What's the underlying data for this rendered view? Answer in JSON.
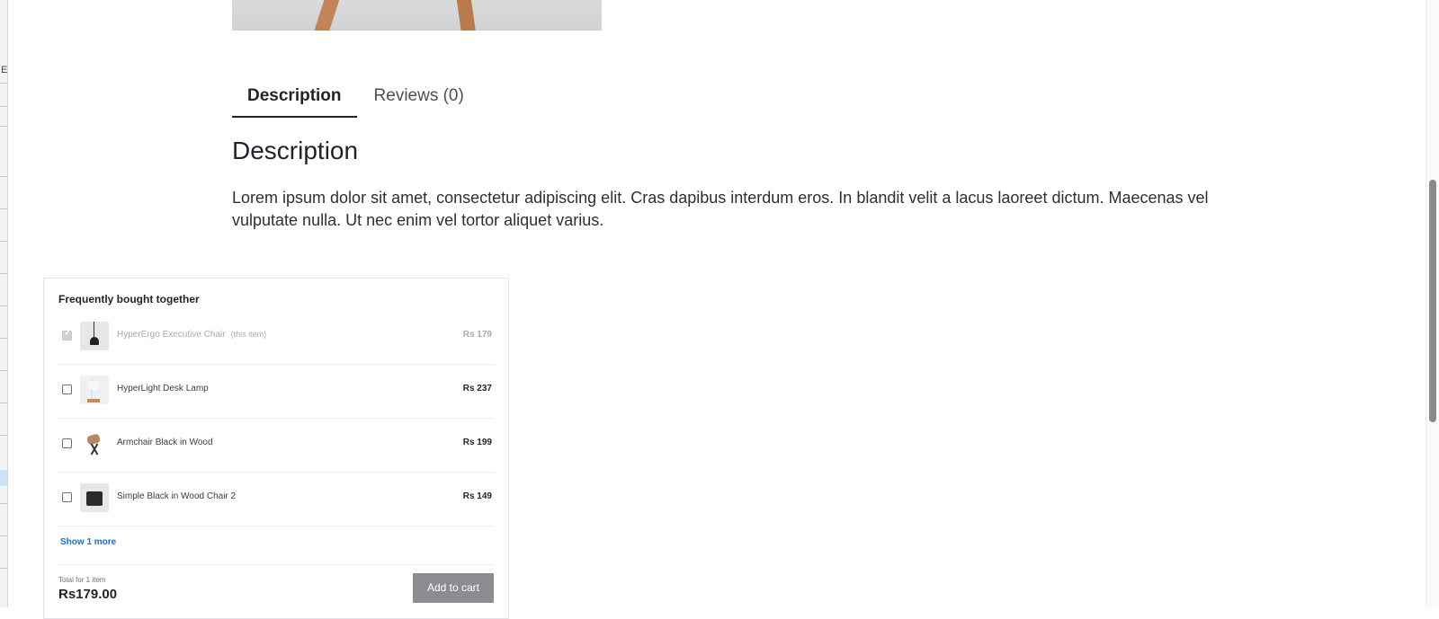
{
  "left_strip": {
    "glyph": "E"
  },
  "tabs": [
    {
      "label": "Description"
    },
    {
      "label": "Reviews (0)"
    }
  ],
  "description": {
    "heading": "Description",
    "text": "Lorem ipsum dolor sit amet, consectetur adipiscing elit. Cras dapibus interdum eros. In blandit velit a lacus laoreet dictum. Maecenas vel vulputate nulla. Ut nec enim vel tortor aliquet varius."
  },
  "fbt": {
    "title": "Frequently bought together",
    "items": [
      {
        "name": "HyperErgo Executive Chair",
        "note": "(this item)",
        "price": "Rs 179",
        "checked": true
      },
      {
        "name": "HyperLight Desk Lamp",
        "price": "Rs 237",
        "checked": false
      },
      {
        "name": "Armchair Black in Wood",
        "price": "Rs 199",
        "checked": false
      },
      {
        "name": "Simple Black in Wood Chair 2",
        "price": "Rs 149",
        "checked": false
      }
    ],
    "show_more": "Show 1 more",
    "total_label": "Total for 1 item",
    "total_value": "Rs179.00",
    "add_to_cart": "Add to cart"
  }
}
